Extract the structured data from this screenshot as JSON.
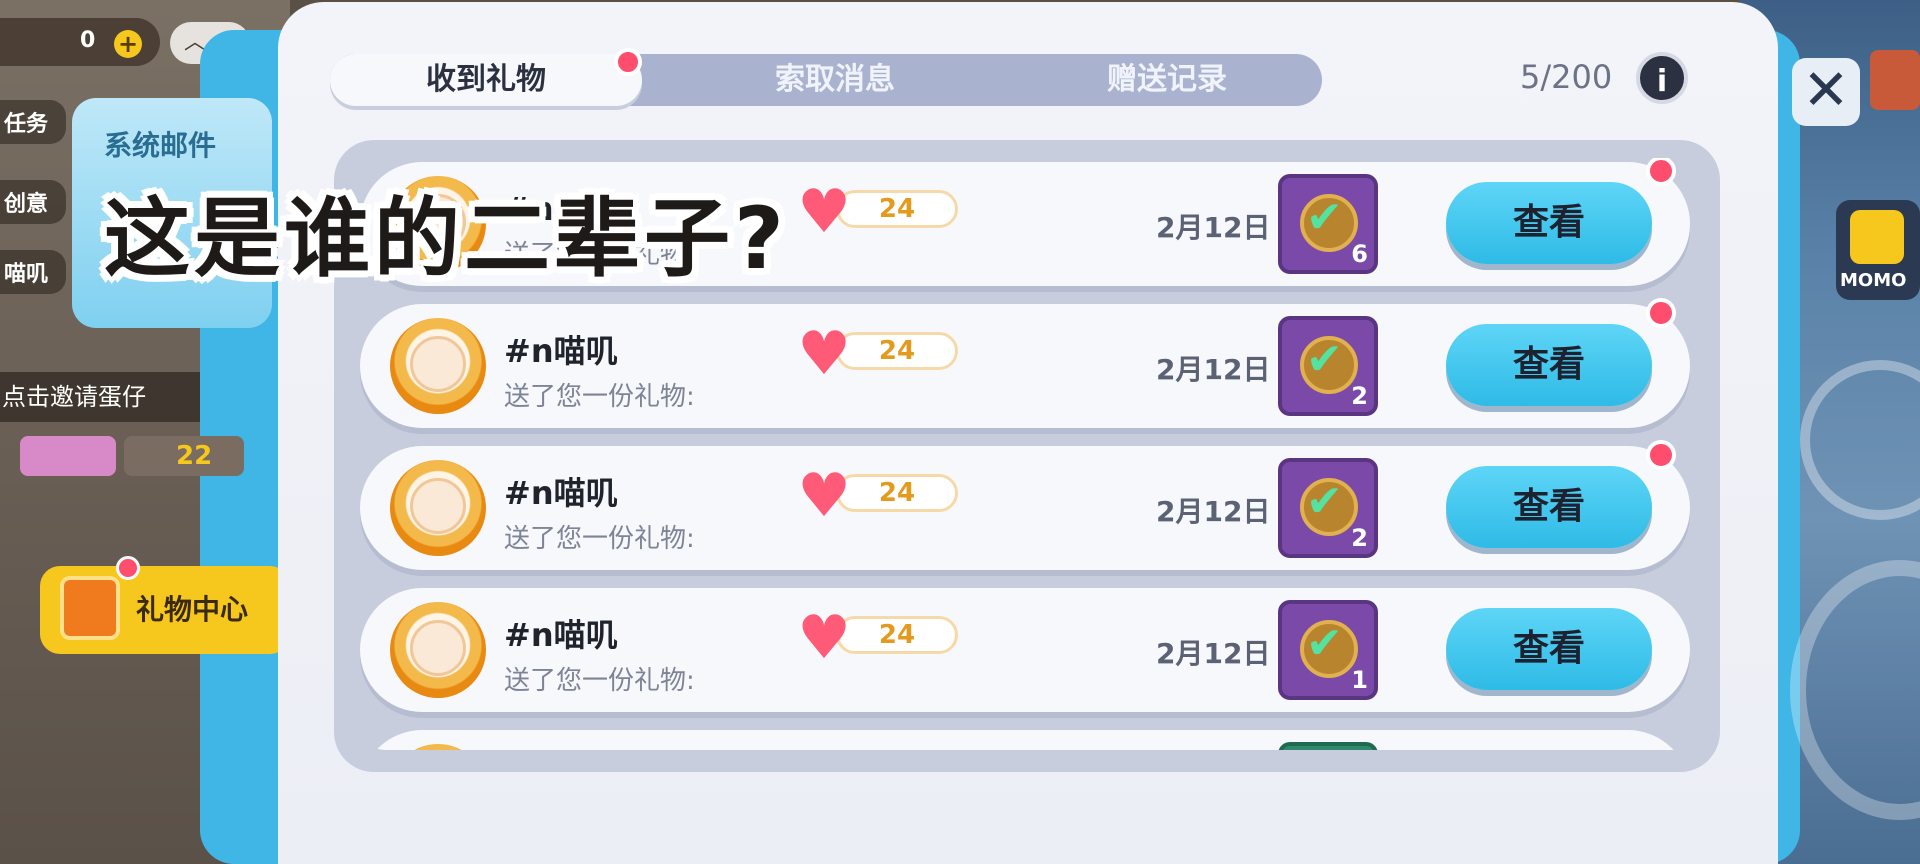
{
  "hud": {
    "coins": "0",
    "plus": "+",
    "side_labels": [
      "任务",
      "创意",
      "喵叽"
    ],
    "mail_tab_label": "系统邮件",
    "invite_label": "点击邀请蛋仔",
    "stat_value": "22",
    "gift_center_label": "礼物中心",
    "momo_label": "MOMO"
  },
  "dialog": {
    "tabs": [
      {
        "label": "收到礼物",
        "active": true
      },
      {
        "label": "索取消息",
        "active": false
      },
      {
        "label": "赠送记录",
        "active": false
      }
    ],
    "count": "5/200",
    "info_icon_glyph": "i",
    "close_glyph": "✕"
  },
  "gifts": [
    {
      "name": "#n喵叽",
      "subtitle": "送了您一份礼物:",
      "hearts": "24",
      "date": "2月12日",
      "qty": "6",
      "button": "查看",
      "unread": true
    },
    {
      "name": "#n喵叽",
      "subtitle": "送了您一份礼物:",
      "hearts": "24",
      "date": "2月12日",
      "qty": "2",
      "button": "查看",
      "unread": true
    },
    {
      "name": "#n喵叽",
      "subtitle": "送了您一份礼物:",
      "hearts": "24",
      "date": "2月12日",
      "qty": "2",
      "button": "查看",
      "unread": true
    },
    {
      "name": "#n喵叽",
      "subtitle": "送了您一份礼物:",
      "hearts": "24",
      "date": "2月12日",
      "qty": "1",
      "button": "查看",
      "unread": false
    }
  ],
  "caption": "这是谁的二辈子?",
  "colors": {
    "accent_blue": "#2ebbe6",
    "notification_red": "#ff4d6d",
    "gift_purple": "#7b4aa8",
    "heart_pink": "#ff5a78"
  }
}
